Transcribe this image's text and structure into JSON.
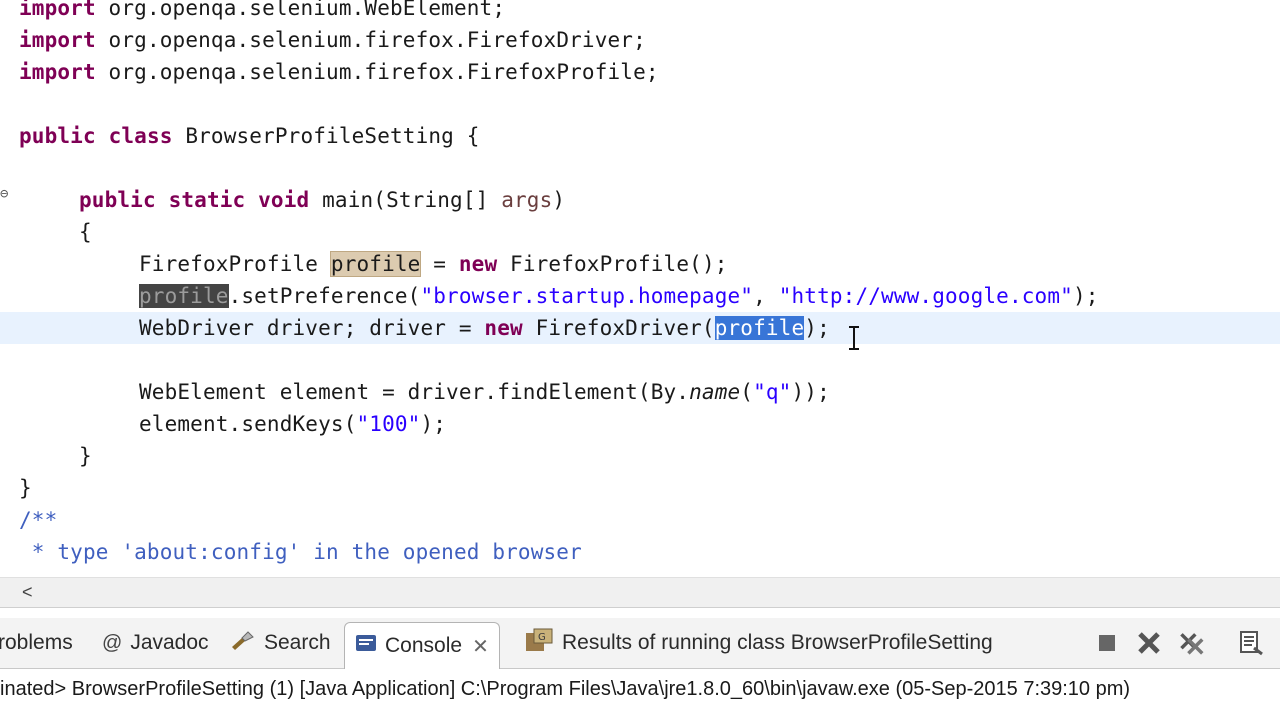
{
  "editor": {
    "lines": {
      "l1": {
        "kw": "import",
        "rest": " org.openqa.selenium.WebElement;"
      },
      "l2": {
        "kw": "import",
        "rest": " org.openqa.selenium.firefox.FirefoxDriver;"
      },
      "l3": {
        "kw": "import",
        "rest": " org.openqa.selenium.firefox.FirefoxProfile;"
      },
      "l5": {
        "kw1": "public",
        "kw2": "class",
        "rest": " BrowserProfileSetting {"
      },
      "l7": {
        "kw1": "public",
        "kw2": "static",
        "kw3": "void",
        "mid": " main(String[] ",
        "param": "args",
        "end": ")"
      },
      "l8": {
        "text": "{"
      },
      "l9": {
        "type": "FirefoxProfile ",
        "var": "profile",
        "mid": " = ",
        "kw": "new",
        "end": " FirefoxProfile();"
      },
      "l10": {
        "var": "profile",
        "mid": ".setPreference(",
        "s1": "\"browser.startup.homepage\"",
        "sep": ", ",
        "s2": "\"http://www.google.com\"",
        "end": ");"
      },
      "l11": {
        "a": "WebDriver driver; driver = ",
        "kw": "new",
        "b": " FirefoxDriver(",
        "sel": "profile",
        "end": ");"
      },
      "l13": {
        "a": "WebElement element = driver.findElement(By.",
        "it": "name",
        "b": "(",
        "s": "\"q\"",
        "end": "));"
      },
      "l14": {
        "a": "element.sendKeys(",
        "s": "\"100\"",
        "end": ");"
      },
      "l15": {
        "text": "}"
      },
      "l16": {
        "text": "}"
      },
      "l17": {
        "text": "/**"
      },
      "l18": {
        "text": " * type 'about:config' in the opened browser"
      }
    },
    "fold_marker": "⊖"
  },
  "panel": {
    "tabs": {
      "problems": "roblems",
      "javadoc": "Javadoc",
      "search": "Search",
      "console": "Console",
      "results": "Results of running class BrowserProfileSetting"
    },
    "status_line": "inated> BrowserProfileSetting (1) [Java Application] C:\\Program Files\\Java\\jre1.8.0_60\\bin\\javaw.exe (05-Sep-2015 7:39:10 pm)"
  },
  "icons": {
    "javadoc": "@",
    "search": "flashlight-icon",
    "console": "console-icon",
    "results": "junit-results-icon",
    "close": "✕",
    "scroll_left": "<"
  },
  "colors": {
    "keyword": "#7f0055",
    "string": "#2a00ff",
    "comment": "#3f5fbf",
    "selection": "#3875d7",
    "current_line": "#e8f2fe"
  }
}
